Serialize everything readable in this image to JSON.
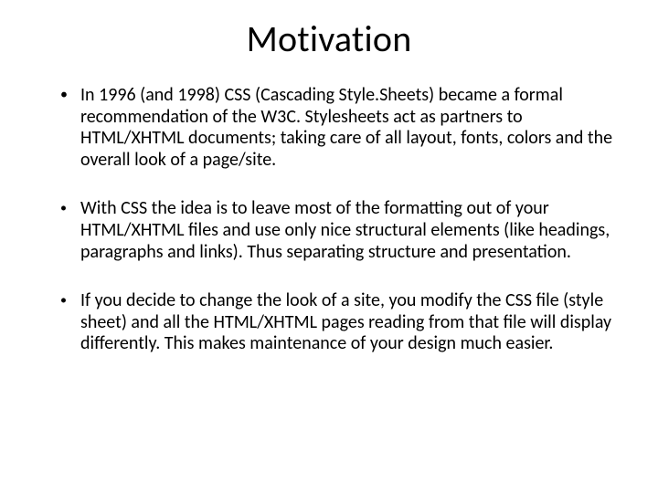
{
  "title": "Motivation",
  "bullets": [
    "In 1996 (and 1998) CSS (Cascading Style.Sheets) became a formal recommendation of the W3C. Stylesheets act as partners to HTML/XHTML documents; taking care of all layout, fonts, colors and the overall look of a page/site.",
    " With CSS the idea is to leave most of the formatting out of your HTML/XHTML files and use only nice structural elements (like headings, paragraphs and links). Thus separating structure and presentation.",
    " If you decide to change the look of a site, you modify the CSS file (style sheet) and all the HTML/XHTML pages reading from that file will display differently. This makes maintenance of your design much easier."
  ]
}
